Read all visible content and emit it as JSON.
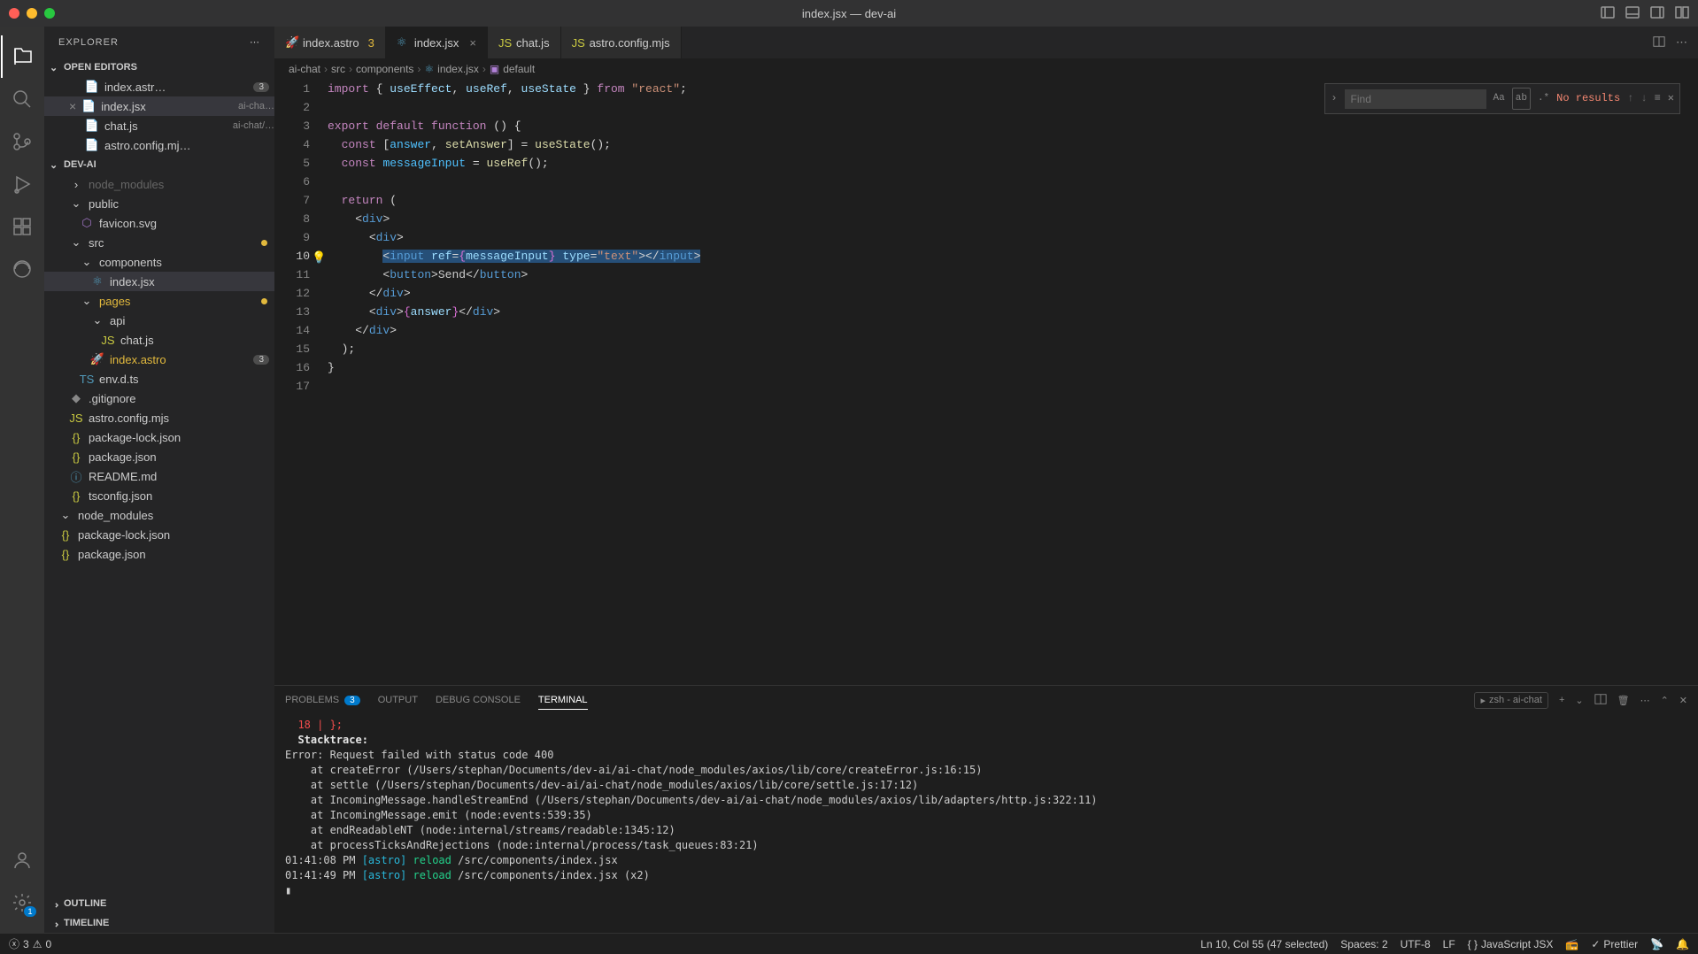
{
  "window": {
    "title": "index.jsx — dev-ai"
  },
  "sidebar": {
    "title": "EXPLORER",
    "sections": {
      "openEditors": {
        "label": "OPEN EDITORS",
        "items": [
          {
            "name": "index.astr…",
            "badge": "3"
          },
          {
            "name": "index.jsx",
            "desc": "ai-cha…",
            "active": true
          },
          {
            "name": "chat.js",
            "desc": "ai-chat/…"
          },
          {
            "name": "astro.config.mj…"
          }
        ]
      },
      "project": {
        "label": "DEV-AI",
        "tree": [
          {
            "name": "node_modules",
            "indent": 1,
            "dim": true
          },
          {
            "name": "public",
            "indent": 1,
            "type": "folder",
            "open": true
          },
          {
            "name": "favicon.svg",
            "indent": 2,
            "icon": "purple"
          },
          {
            "name": "src",
            "indent": 1,
            "type": "folder",
            "open": true,
            "modified": true
          },
          {
            "name": "components",
            "indent": 2,
            "type": "folder",
            "open": true
          },
          {
            "name": "index.jsx",
            "indent": 3,
            "icon": "react",
            "active": true
          },
          {
            "name": "pages",
            "indent": 2,
            "type": "folder",
            "open": true,
            "modified": true,
            "colorClass": "folder-orange"
          },
          {
            "name": "api",
            "indent": 3,
            "type": "folder",
            "open": true
          },
          {
            "name": "chat.js",
            "indent": 4,
            "icon": "js"
          },
          {
            "name": "index.astro",
            "indent": 3,
            "icon": "astro",
            "badge": "3",
            "colorClass": "folder-orange"
          },
          {
            "name": "env.d.ts",
            "indent": 2,
            "icon": "ts"
          },
          {
            "name": ".gitignore",
            "indent": 1,
            "icon": "git"
          },
          {
            "name": "astro.config.mjs",
            "indent": 1,
            "icon": "js"
          },
          {
            "name": "package-lock.json",
            "indent": 1,
            "icon": "json"
          },
          {
            "name": "package.json",
            "indent": 1,
            "icon": "json"
          },
          {
            "name": "README.md",
            "indent": 1,
            "icon": "md"
          },
          {
            "name": "tsconfig.json",
            "indent": 1,
            "icon": "json"
          },
          {
            "name": "node_modules",
            "indent": 0,
            "type": "folder"
          },
          {
            "name": "package-lock.json",
            "indent": 0,
            "icon": "json"
          },
          {
            "name": "package.json",
            "indent": 0,
            "icon": "json"
          }
        ]
      },
      "outline": {
        "label": "OUTLINE"
      },
      "timeline": {
        "label": "TIMELINE"
      }
    }
  },
  "tabs": [
    {
      "name": "index.astro",
      "icon": "astro",
      "badge": "3"
    },
    {
      "name": "index.jsx",
      "icon": "react",
      "active": true,
      "close": true
    },
    {
      "name": "chat.js",
      "icon": "js"
    },
    {
      "name": "astro.config.mjs",
      "icon": "js"
    }
  ],
  "breadcrumbs": [
    "ai-chat",
    "src",
    "components",
    "index.jsx",
    "default"
  ],
  "find": {
    "placeholder": "Find",
    "result": "No results"
  },
  "code": {
    "lines": 17,
    "content": [
      "import { useEffect, useRef, useState } from \"react\";",
      "",
      "export default function () {",
      "  const [answer, setAnswer] = useState();",
      "  const messageInput = useRef();",
      "",
      "  return (",
      "    <div>",
      "      <div>",
      "        <input ref={messageInput} type=\"text\"></input>",
      "        <button>Send</button>",
      "      </div>",
      "      <div>{answer}</div>",
      "    </div>",
      "  );",
      "}",
      ""
    ]
  },
  "panel": {
    "tabs": {
      "problems": {
        "label": "PROBLEMS",
        "count": "3"
      },
      "output": {
        "label": "OUTPUT"
      },
      "debug": {
        "label": "DEBUG CONSOLE"
      },
      "terminal": {
        "label": "TERMINAL"
      }
    },
    "terminalName": "zsh - ai-chat",
    "terminal": [
      {
        "text": "  18 | };",
        "cls": "term-red"
      },
      {
        "text": "  Stacktrace:",
        "cls": "term-white"
      },
      {
        "text": "Error: Request failed with status code 400"
      },
      {
        "text": "    at createError (/Users/stephan/Documents/dev-ai/ai-chat/node_modules/axios/lib/core/createError.js:16:15)"
      },
      {
        "text": "    at settle (/Users/stephan/Documents/dev-ai/ai-chat/node_modules/axios/lib/core/settle.js:17:12)"
      },
      {
        "text": "    at IncomingMessage.handleStreamEnd (/Users/stephan/Documents/dev-ai/ai-chat/node_modules/axios/lib/adapters/http.js:322:11)"
      },
      {
        "text": "    at IncomingMessage.emit (node:events:539:35)"
      },
      {
        "text": "    at endReadableNT (node:internal/streams/readable:1345:12)"
      },
      {
        "text": "    at processTicksAndRejections (node:internal/process/task_queues:83:21)"
      },
      {
        "text": ""
      },
      {
        "segments": [
          {
            "t": "01:41:08 PM ",
            "c": ""
          },
          {
            "t": "[astro]",
            "c": "term-cyan"
          },
          {
            "t": " ",
            "c": ""
          },
          {
            "t": "reload",
            "c": "term-green"
          },
          {
            "t": " /src/components/index.jsx",
            "c": ""
          }
        ]
      },
      {
        "segments": [
          {
            "t": "01:41:49 PM ",
            "c": ""
          },
          {
            "t": "[astro]",
            "c": "term-cyan"
          },
          {
            "t": " ",
            "c": ""
          },
          {
            "t": "reload",
            "c": "term-green"
          },
          {
            "t": " /src/components/index.jsx (x2)",
            "c": ""
          }
        ]
      },
      {
        "text": "▮"
      }
    ]
  },
  "status": {
    "errors": "3",
    "warnings": "0",
    "position": "Ln 10, Col 55 (47 selected)",
    "spaces": "Spaces: 2",
    "encoding": "UTF-8",
    "eol": "LF",
    "lang": "JavaScript JSX",
    "prettier": "Prettier"
  }
}
